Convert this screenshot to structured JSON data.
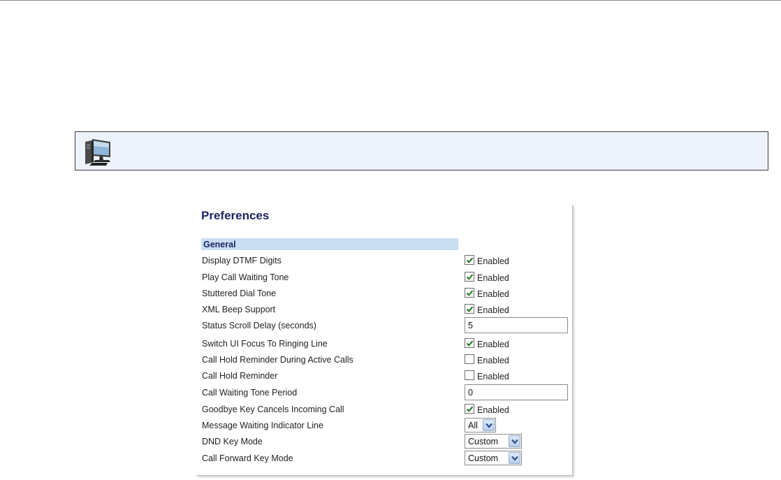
{
  "note": {
    "icon": "computer-workstation-icon"
  },
  "panel": {
    "title": "Preferences",
    "section": "General",
    "rows": [
      {
        "label": "Display DTMF Digits",
        "control": "checkbox",
        "checked": true,
        "option": "Enabled"
      },
      {
        "label": "Play Call Waiting Tone",
        "control": "checkbox",
        "checked": true,
        "option": "Enabled"
      },
      {
        "label": "Stuttered Dial Tone",
        "control": "checkbox",
        "checked": true,
        "option": "Enabled"
      },
      {
        "label": "XML Beep Support",
        "control": "checkbox",
        "checked": true,
        "option": "Enabled"
      },
      {
        "label": "Status Scroll Delay (seconds)",
        "control": "text",
        "value": "5"
      },
      {
        "label": "Switch UI Focus To Ringing Line",
        "control": "checkbox",
        "checked": true,
        "option": "Enabled"
      },
      {
        "label": "Call Hold Reminder During Active Calls",
        "control": "checkbox",
        "checked": false,
        "option": "Enabled"
      },
      {
        "label": "Call Hold Reminder",
        "control": "checkbox",
        "checked": false,
        "option": "Enabled"
      },
      {
        "label": "Call Waiting Tone Period",
        "control": "text",
        "value": "0"
      },
      {
        "label": "Goodbye Key Cancels Incoming Call",
        "control": "checkbox",
        "checked": true,
        "option": "Enabled"
      },
      {
        "label": "Message Waiting Indicator Line",
        "control": "select",
        "value": "All"
      },
      {
        "label": "DND Key Mode",
        "control": "select",
        "value": "Custom"
      },
      {
        "label": "Call Forward Key Mode",
        "control": "select",
        "value": "Custom"
      }
    ]
  },
  "colors": {
    "title": "#1e2460",
    "section_bg": "#c9ddf3",
    "note_bg": "#eef3fb",
    "check": "#1a7a1a"
  }
}
